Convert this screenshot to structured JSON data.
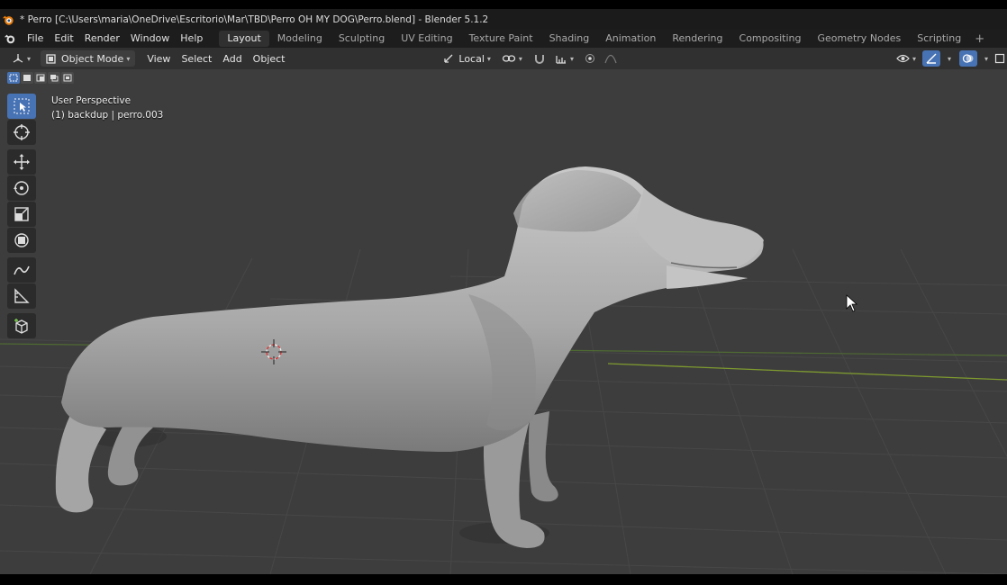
{
  "window": {
    "title": "* Perro [C:\\Users\\maria\\OneDrive\\Escritorio\\Mar\\TBD\\Perro OH MY DOG\\Perro.blend] - Blender 5.1.2"
  },
  "menubar": {
    "menus": [
      "File",
      "Edit",
      "Render",
      "Window",
      "Help"
    ],
    "workspaces": [
      "Layout",
      "Modeling",
      "Sculpting",
      "UV Editing",
      "Texture Paint",
      "Shading",
      "Animation",
      "Rendering",
      "Compositing",
      "Geometry Nodes",
      "Scripting"
    ],
    "active_workspace": "Layout",
    "add_workspace": "+"
  },
  "header": {
    "mode": "Object Mode",
    "menus": [
      "View",
      "Select",
      "Add",
      "Object"
    ],
    "transform_orientation": "Local"
  },
  "viewport": {
    "view_name": "User Perspective",
    "collection_info": "(1) backdup | perro.003"
  },
  "toolbar": {
    "tools": [
      "select-box-icon",
      "cursor-icon",
      "move-icon",
      "rotate-icon",
      "scale-icon",
      "transform-icon",
      "annotate-icon",
      "measure-icon",
      "add-cube-icon"
    ],
    "active_tool": "select-box-icon"
  },
  "colors": {
    "accent": "#4772b3",
    "viewport_bg": "#3d3d3d",
    "header_bg": "#303030",
    "topbar_bg": "#1d1d1d",
    "x_axis": "#8a3a44",
    "y_axis": "#6e8f2a"
  }
}
